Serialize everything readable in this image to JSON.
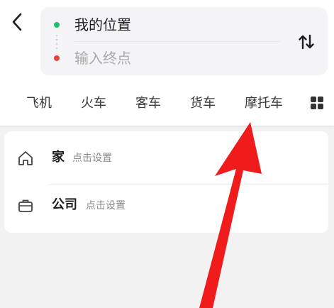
{
  "colors": {
    "start_dot": "#1fbf6b",
    "end_dot": "#e8423c",
    "annotation_arrow": "#f01c1c"
  },
  "header": {
    "back_icon": "chevron-left-icon",
    "start_location": "我的位置",
    "end_placeholder": "输入终点",
    "swap_icon": "swap-vertical-icon"
  },
  "tabs": [
    {
      "label": "飞机"
    },
    {
      "label": "火车"
    },
    {
      "label": "客车"
    },
    {
      "label": "货车"
    },
    {
      "label": "摩托车"
    }
  ],
  "tabs_more_icon": "grid-icon",
  "places": {
    "home": {
      "icon": "home-icon",
      "name": "家",
      "hint": "点击设置"
    },
    "company": {
      "icon": "briefcase-icon",
      "name": "公司",
      "hint": "点击设置"
    }
  }
}
